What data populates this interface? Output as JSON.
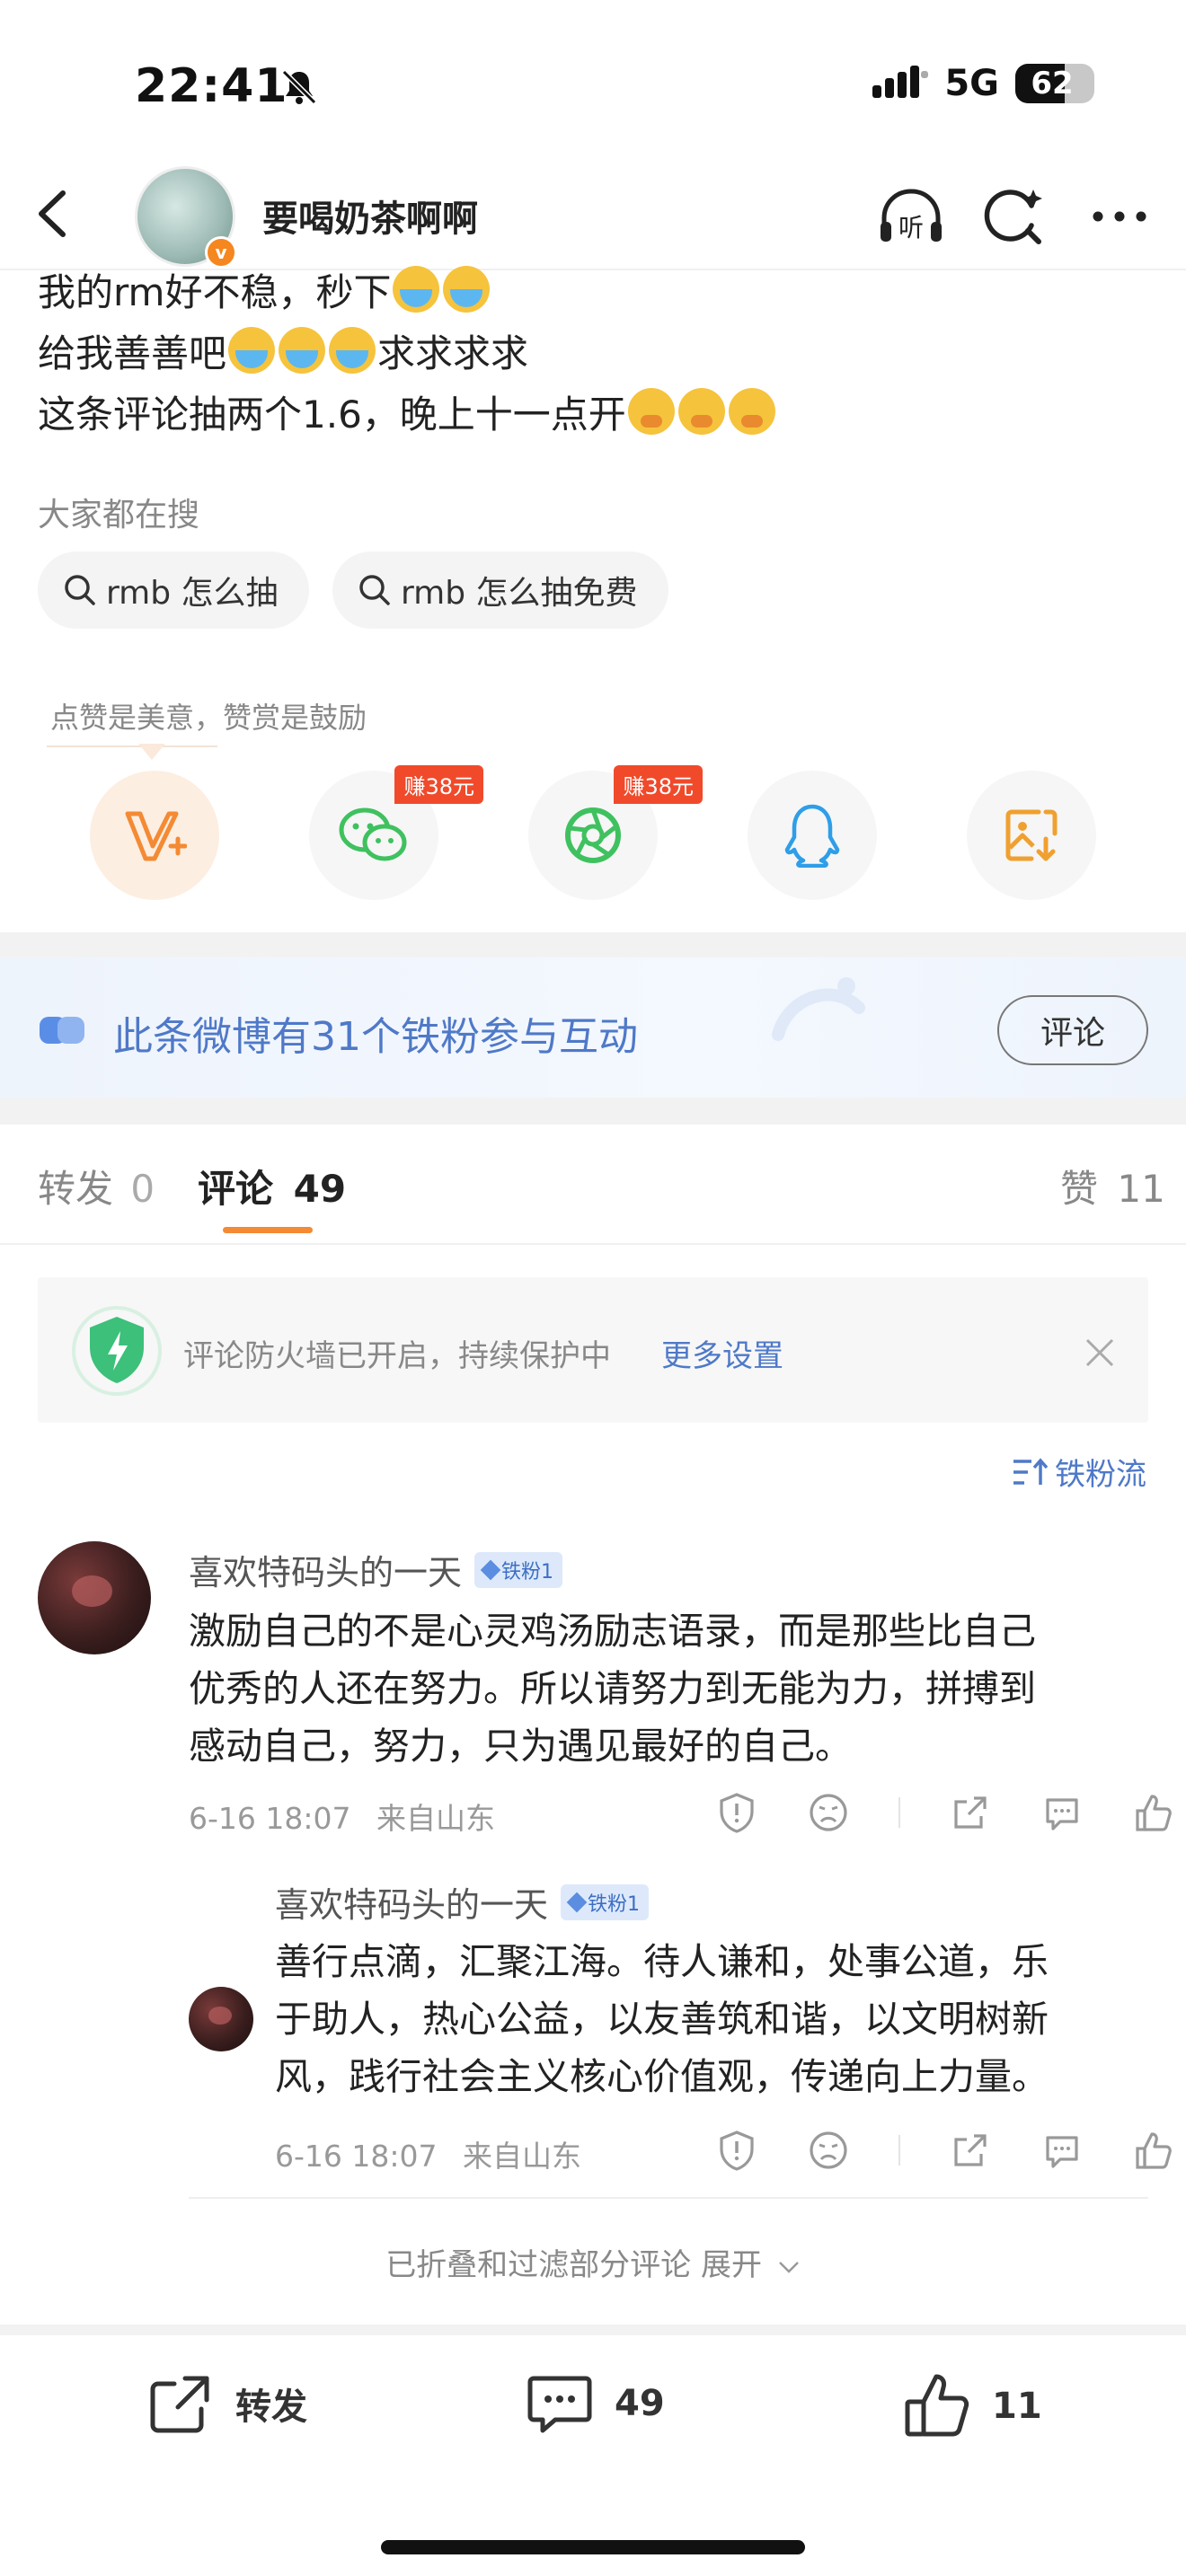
{
  "status_bar": {
    "time": "22:41",
    "network": "5G",
    "battery": "62",
    "battery_level_percent": 62
  },
  "header": {
    "username": "要喝奶茶啊啊",
    "verified_badge": "v",
    "icons": [
      "back-icon",
      "listen-icon",
      "search-icon",
      "more-icon"
    ]
  },
  "post": {
    "line1": "我的rm好不稳，秒下",
    "line2_prefix": "给我善善吧",
    "line2_suffix": "求求求求",
    "line3": "这条评论抽两个1.6，晚上十一点开"
  },
  "search_section": {
    "label": "大家都在搜",
    "chips": [
      "rmb 怎么抽",
      "rmb 怎么抽免费"
    ]
  },
  "share": {
    "label": "点赞是美意，赞赏是鼓励",
    "earn_badge_wechat": "赚38元",
    "earn_badge_moments": "赚38元"
  },
  "fan_banner": {
    "text": "此条微博有31个铁粉参与互动",
    "button": "评论"
  },
  "tabs": {
    "repost_label": "转发",
    "repost_count": "0",
    "comment_label": "评论",
    "comment_count": "49",
    "like_label": "赞",
    "like_count": "11"
  },
  "firewall": {
    "text": "评论防火墙已开启，持续保护中",
    "link": "更多设置"
  },
  "sort": {
    "label": "铁粉流"
  },
  "comments": [
    {
      "author": "喜欢特码头的一天",
      "badge": "铁粉1",
      "lines": [
        "激励自己的不是心灵鸡汤励志语录，而是那些比自己",
        "优秀的人还在努力。所以请努力到无能为力，拼搏到",
        "感动自己，努力，只为遇见最好的自己。"
      ],
      "time": "6-16 18:07",
      "location": "来自山东"
    },
    {
      "author": "喜欢特码头的一天",
      "badge": "铁粉1",
      "lines": [
        "善行点滴，汇聚江海。待人谦和，处事公道，乐",
        "于助人，热心公益，以友善筑和谐，以文明树新",
        "风，践行社会主义核心价值观，传递向上力量。"
      ],
      "time": "6-16 18:07",
      "location": "来自山东"
    }
  ],
  "folded_text": "已折叠和过滤部分评论 展开",
  "bottom_bar": {
    "repost": "转发",
    "comments": "49",
    "likes": "11"
  },
  "colors": {
    "accent_orange": "#f48a33",
    "link_blue": "#4f79c8",
    "badge_red": "#f04a2b",
    "wechat_green": "#3fc15f",
    "qq_blue": "#2f9ee8"
  }
}
